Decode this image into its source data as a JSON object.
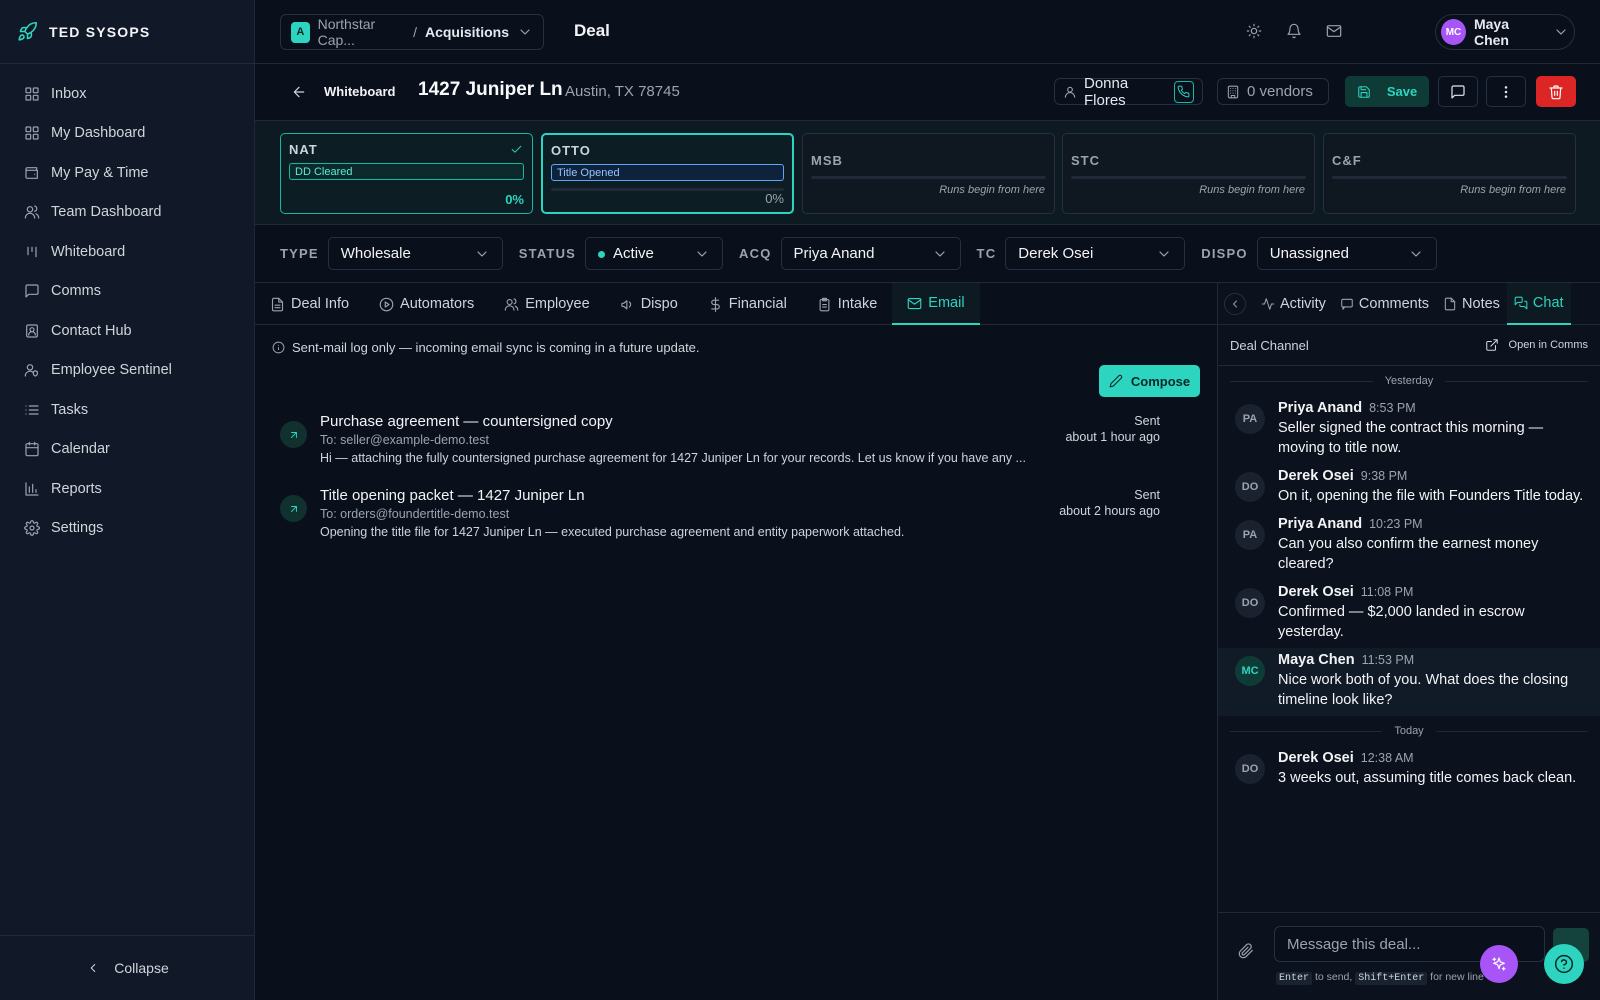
{
  "brand": {
    "name": "TED SYSOPS"
  },
  "sidebar": {
    "items": [
      {
        "label": "Inbox",
        "icon": "inbox-icon"
      },
      {
        "label": "My Dashboard",
        "icon": "grid-icon"
      },
      {
        "label": "My Pay & Time",
        "icon": "wallet-icon"
      },
      {
        "label": "Team Dashboard",
        "icon": "users-icon"
      },
      {
        "label": "Whiteboard",
        "icon": "kanban-icon"
      },
      {
        "label": "Comms",
        "icon": "message-icon"
      },
      {
        "label": "Contact Hub",
        "icon": "contact-icon"
      },
      {
        "label": "Employee Sentinel",
        "icon": "user-shield-icon"
      },
      {
        "label": "Tasks",
        "icon": "list-icon"
      },
      {
        "label": "Calendar",
        "icon": "calendar-icon"
      },
      {
        "label": "Reports",
        "icon": "chart-icon"
      },
      {
        "label": "Settings",
        "icon": "gear-icon"
      }
    ],
    "collapse_label": "Collapse"
  },
  "topbar": {
    "org_initial": "A",
    "org_name": "Northstar Cap...",
    "separator": "/",
    "workspace": "Acquisitions",
    "page_title": "Deal",
    "user": {
      "initials": "MC",
      "name": "Maya Chen"
    }
  },
  "deal": {
    "back_label": "Whiteboard",
    "address": "1427 Juniper Ln",
    "city": "Austin, TX 78745",
    "owner": "Donna Flores",
    "vendors": "0 vendors",
    "save_label": "Save"
  },
  "stages": [
    {
      "name": "NAT",
      "badge": "DD Cleared",
      "pct": "0%",
      "progress": 0,
      "note": ""
    },
    {
      "name": "OTTO",
      "badge": "Title Opened",
      "pct": "0%",
      "progress": 0,
      "note": ""
    },
    {
      "name": "MSB",
      "badge": "",
      "pct": "",
      "progress": 0,
      "note": "Runs begin from here"
    },
    {
      "name": "STC",
      "badge": "",
      "pct": "",
      "progress": 0,
      "note": "Runs begin from here"
    },
    {
      "name": "C&F",
      "badge": "",
      "pct": "",
      "progress": 0,
      "note": "Runs begin from here"
    }
  ],
  "fields": {
    "type": {
      "label": "TYPE",
      "value": "Wholesale"
    },
    "status": {
      "label": "STATUS",
      "value": "Active",
      "color": "#2dd4bf"
    },
    "acq": {
      "label": "ACQ",
      "value": "Priya Anand"
    },
    "tc": {
      "label": "TC",
      "value": "Derek Osei"
    },
    "dispo": {
      "label": "DISPO",
      "value": "Unassigned"
    }
  },
  "tabs": [
    {
      "label": "Deal Info"
    },
    {
      "label": "Automators"
    },
    {
      "label": "Employee"
    },
    {
      "label": "Dispo"
    },
    {
      "label": "Financial"
    },
    {
      "label": "Intake"
    },
    {
      "label": "Email",
      "active": true
    }
  ],
  "email": {
    "notice": "Sent-mail log only — incoming email sync is coming in a future update.",
    "compose_label": "Compose",
    "items": [
      {
        "subject": "Purchase agreement — countersigned copy",
        "to": "To: seller@example-demo.test",
        "snippet": "Hi — attaching the fully countersigned purchase agreement for 1427 Juniper Ln for your records. Let us know if you have any ...",
        "status": "Sent",
        "time": "about 1 hour ago"
      },
      {
        "subject": "Title opening packet — 1427 Juniper Ln",
        "to": "To: orders@foundertitle-demo.test",
        "snippet": "Opening the title file for 1427 Juniper Ln — executed purchase agreement and entity paperwork attached.",
        "status": "Sent",
        "time": "about 2 hours ago"
      }
    ]
  },
  "right_panel": {
    "tabs": [
      {
        "label": "Activity"
      },
      {
        "label": "Comments"
      },
      {
        "label": "Notes"
      },
      {
        "label": "Chat",
        "active": true
      }
    ],
    "channel_name": "Deal Channel",
    "open_in_comms": "Open in Comms",
    "day_yesterday": "Yesterday",
    "day_today": "Today",
    "messages": [
      {
        "initials": "PA",
        "name": "Priya Anand",
        "time": "8:53 PM",
        "text": "Seller signed the contract this morning — moving to title now."
      },
      {
        "initials": "DO",
        "name": "Derek Osei",
        "time": "9:38 PM",
        "text": "On it, opening the file with Founders Title today."
      },
      {
        "initials": "PA",
        "name": "Priya Anand",
        "time": "10:23 PM",
        "text": "Can you also confirm the earnest money cleared?"
      },
      {
        "initials": "DO",
        "name": "Derek Osei",
        "time": "11:08 PM",
        "text": "Confirmed — $2,000 landed in escrow yesterday."
      },
      {
        "initials": "MC",
        "name": "Maya Chen",
        "time": "11:53 PM",
        "text": "Nice work both of you. What does the closing timeline look like?"
      },
      {
        "initials": "DO",
        "name": "Derek Osei",
        "time": "12:38 AM",
        "text": "3 weeks out, assuming title comes back clean."
      }
    ],
    "composer": {
      "placeholder": "Message this deal...",
      "hint_key1": "Enter",
      "hint_mid": "to send,",
      "hint_key2": "Shift+Enter",
      "hint_end": "for new line"
    }
  },
  "colors": {
    "accent": "#2dd4bf",
    "danger": "#dc2626",
    "ai": "#a855f7",
    "background": "#0a0f1c"
  }
}
